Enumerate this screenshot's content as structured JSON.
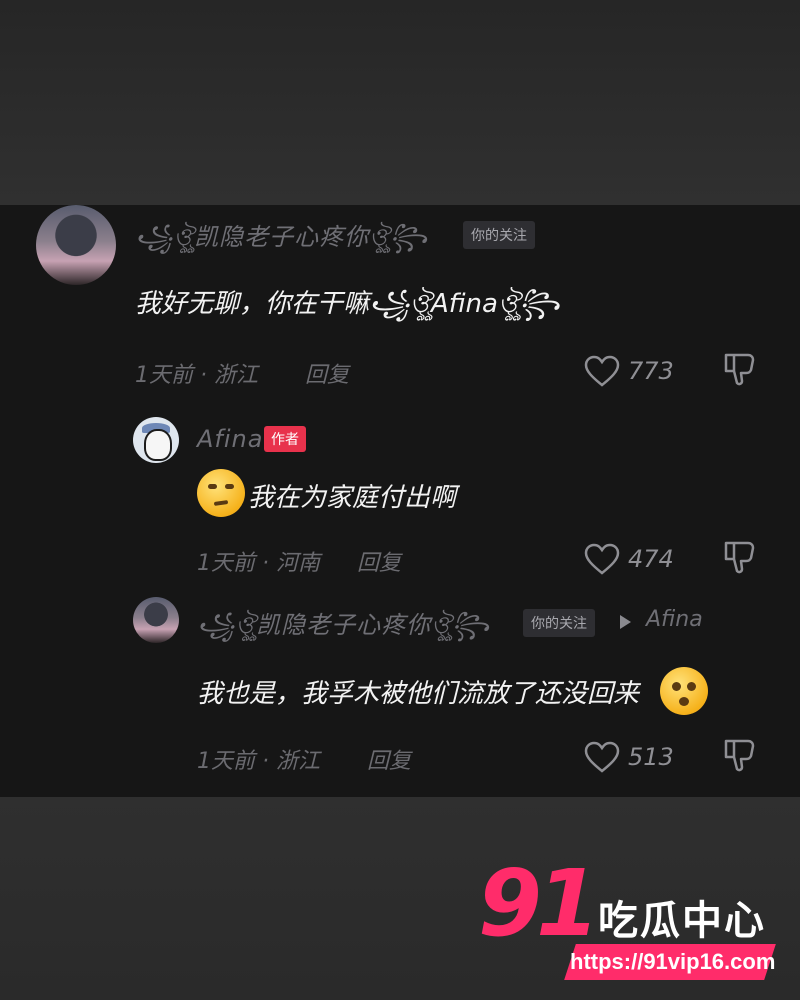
{
  "comments": [
    {
      "name": "꧁ঔৣ凯隐老子心疼你ঔৣ꧂",
      "follow_badge": "你的关注",
      "text": "我好无聊，你在干嘛꧁ঔৣAfinaঔৣ꧂",
      "time": "1天前",
      "location": "浙江",
      "reply_label": "回复",
      "likes": "773",
      "avatar_icon": "anime-girl-avatar"
    },
    {
      "name": "Afina",
      "author_badge": "作者",
      "text": "我在为家庭付出啊",
      "emoji_icon": "eye-roll-emoji",
      "time": "1天前",
      "location": "河南",
      "reply_label": "回复",
      "likes": "474",
      "avatar_icon": "penguin-avatar"
    },
    {
      "name": "꧁ঔৣ凯隐老子心疼你ঔৣ꧂",
      "follow_badge": "你的关注",
      "reply_to": "Afina",
      "text": "我也是，我孚木被他们流放了还没回来",
      "emoji_icon": "pleading-emoji",
      "time": "1天前",
      "location": "浙江",
      "reply_label": "回复",
      "likes": "513",
      "avatar_icon": "anime-girl-avatar"
    }
  ],
  "watermark": {
    "number": "91",
    "title": "吃瓜中心",
    "url": "https://91vip16.com"
  },
  "colors": {
    "panel_bg": "#161616",
    "author_badge": "#e8324c",
    "watermark_pink": "#ff2c6a"
  }
}
